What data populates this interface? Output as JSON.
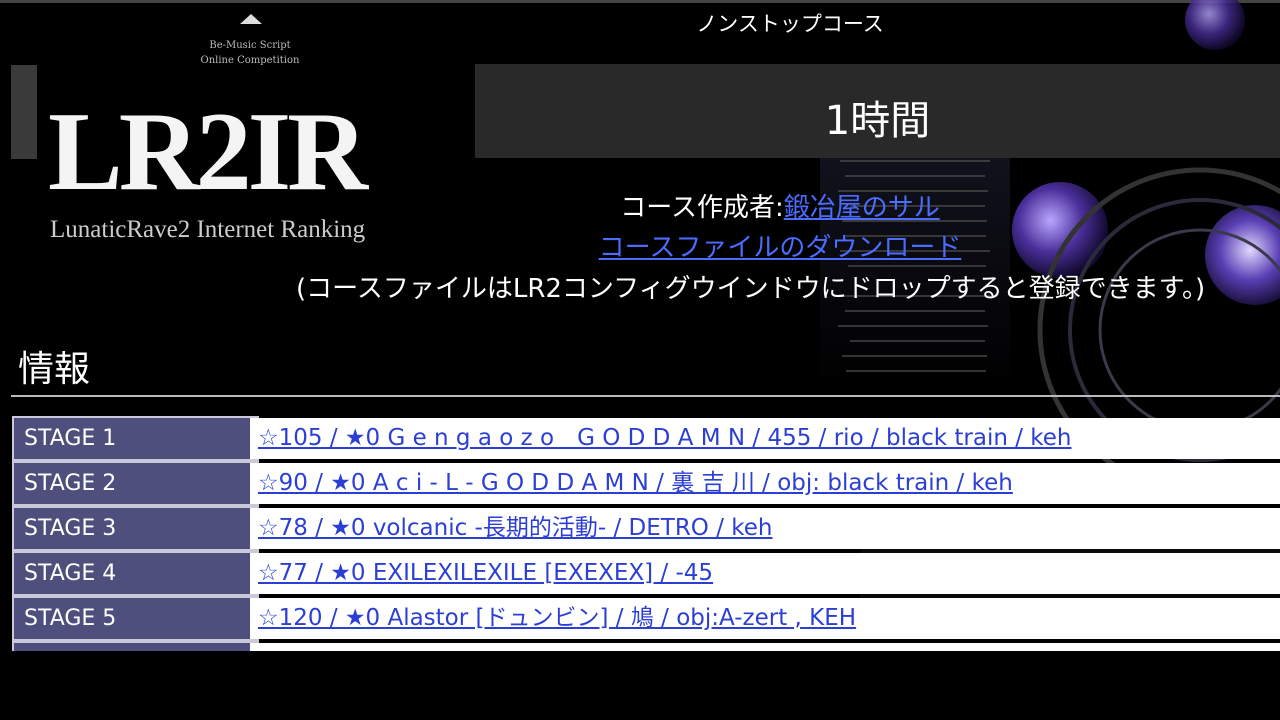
{
  "logo": {
    "subtitle": "Be-Music Script\nOnline Competition",
    "wordmark": "LR2IR",
    "caption": "LunaticRave2 Internet Ranking"
  },
  "header": {
    "course_type": "ノンストップコース",
    "course_title": "1時間"
  },
  "info": {
    "creator_label": "コース作成者:",
    "creator_name": "鍛冶屋のサル",
    "download_link": "コースファイルのダウンロード",
    "note": "(コースファイルはLR2コンフィグウインドウにドロップすると登録できます。)"
  },
  "section": {
    "title": "情報"
  },
  "stages": [
    {
      "label": "STAGE 1",
      "song": "☆105 / ★0 G e n g a o z o　G O D D A M N / 455 / rio / black train / keh"
    },
    {
      "label": "STAGE 2",
      "song": "☆90 / ★0 A c i - L - G O D D A M N / 裏 吉 川 / obj: black train / keh"
    },
    {
      "label": "STAGE 3",
      "song": "☆78 / ★0 volcanic -長期的活動- / DETRO / keh"
    },
    {
      "label": "STAGE 4",
      "song": "☆77 / ★0 EXILEXILEXILE [EXEXEX] / -45"
    },
    {
      "label": "STAGE 5",
      "song": "☆120 / ★0 Alastor [ドュンビン] / 鳩 / obj:A-zert , KEH"
    }
  ],
  "colors": {
    "background": "#000000",
    "title_bar": "#292929",
    "stage_label_bg": "#4f4f7d",
    "link": "#2c3fd4",
    "info_link": "#4b6cff"
  }
}
